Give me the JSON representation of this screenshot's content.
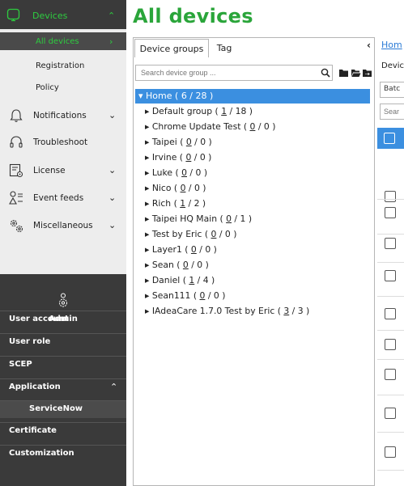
{
  "sidebar": {
    "devices_label": "Devices",
    "sub_items": [
      "All devices",
      "Registration",
      "Policy"
    ],
    "main_items": [
      {
        "label": "Notifications",
        "icon": "bell-icon",
        "has_chevron": true
      },
      {
        "label": "Troubleshoot",
        "icon": "headset-icon",
        "has_chevron": false
      },
      {
        "label": "License",
        "icon": "license-icon",
        "has_chevron": true
      },
      {
        "label": "Event feeds",
        "icon": "event-feeds-icon",
        "has_chevron": true
      },
      {
        "label": "Miscellaneous",
        "icon": "gears-icon",
        "has_chevron": true
      }
    ],
    "admin": {
      "label": "Admin",
      "items": [
        "User account",
        "User role",
        "SCEP",
        "Application",
        "ServiceNow",
        "Certificate",
        "Customization"
      ]
    }
  },
  "page_title": "All devices",
  "tabs": [
    "Device groups",
    "Tag"
  ],
  "search": {
    "placeholder": "Search device group ..."
  },
  "tree": {
    "home": {
      "name": "Home",
      "online": "6",
      "total": "28"
    },
    "groups": [
      {
        "name": "Default group",
        "online": "1",
        "total": "18"
      },
      {
        "name": "Chrome Update Test",
        "online": "0",
        "total": "0"
      },
      {
        "name": "Taipei",
        "online": "0",
        "total": "0"
      },
      {
        "name": "Irvine",
        "online": "0",
        "total": "0"
      },
      {
        "name": "Luke",
        "online": "0",
        "total": "0"
      },
      {
        "name": "Nico",
        "online": "0",
        "total": "0"
      },
      {
        "name": "Rich",
        "online": "1",
        "total": "2"
      },
      {
        "name": "Taipei HQ Main",
        "online": "0",
        "total": "1"
      },
      {
        "name": "Test by Eric",
        "online": "0",
        "total": "0"
      },
      {
        "name": "Layer1",
        "online": "0",
        "total": "0"
      },
      {
        "name": "Sean",
        "online": "0",
        "total": "0"
      },
      {
        "name": "Daniel",
        "online": "1",
        "total": "4"
      },
      {
        "name": "Sean111",
        "online": "0",
        "total": "0"
      },
      {
        "name": "IAdeaCare 1.7.0 Test by Eric",
        "online": "3",
        "total": "3"
      }
    ]
  },
  "right": {
    "breadcrumb": "Hom",
    "section_label": "Devic",
    "batch_label": "Batc",
    "search_placeholder": "Sear"
  },
  "colors": {
    "accent": "#2aa53a",
    "selection": "#3b8fe0",
    "sidebar_dark": "#3a3a3a"
  }
}
